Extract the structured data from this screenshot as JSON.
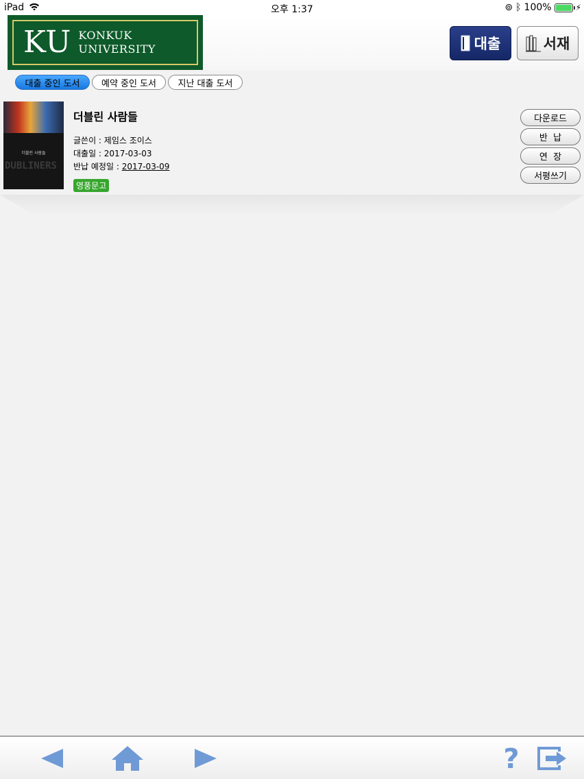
{
  "status_bar": {
    "device": "iPad",
    "time": "오후 1:37",
    "battery": "100%"
  },
  "header": {
    "logo_ku": "KU",
    "logo_line1": "KONKUK",
    "logo_line2": "UNIVERSITY",
    "loan_button": "대출",
    "shelf_button": "서재"
  },
  "tabs": [
    {
      "label": "대출 중인 도서",
      "active": true
    },
    {
      "label": "예약 중인 도서",
      "active": false
    },
    {
      "label": "지난 대출 도서",
      "active": false
    }
  ],
  "book": {
    "title": "더블린 사람들",
    "author": "글쓴이 : 제임스 조이스",
    "loan_date": "대출일 : 2017-03-03",
    "due_label": "반납 예정일 : ",
    "due_date": "2017-03-09",
    "publisher": "영풍문고",
    "cover_title": "더블린 사람들",
    "cover_text": "DUBLINERS"
  },
  "actions": {
    "download": "다운로드",
    "return": "반  납",
    "extend": "연  장",
    "review": "서평쓰기"
  },
  "toolbar": {
    "back_icon": "back-arrow-icon",
    "home_icon": "home-icon",
    "forward_icon": "forward-arrow-icon",
    "help_icon": "help-icon",
    "logout_icon": "logout-icon"
  },
  "colors": {
    "logo_green": "#0e5a2a",
    "active_tab": "#1878e0",
    "loan_button": "#142766",
    "badge_green": "#37a62e",
    "toolbar_icon": "#6f9ad6"
  }
}
